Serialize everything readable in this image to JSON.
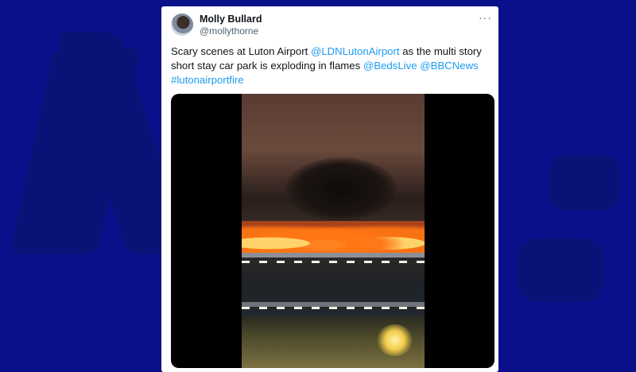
{
  "tweet": {
    "author_name": "Molly Bullard",
    "author_handle": "@mollythorne",
    "more_icon": "···",
    "text_parts": [
      {
        "text": "Scary scenes at Luton Airport ",
        "type": "plain"
      },
      {
        "text": "@LDNLutonAirport",
        "type": "link"
      },
      {
        "text": " as the multi story short stay car park is exploding in flames ",
        "type": "plain"
      },
      {
        "text": "@BedsLive",
        "type": "link"
      },
      {
        "text": " ",
        "type": "plain"
      },
      {
        "text": "@BBCNews",
        "type": "link"
      },
      {
        "text": " ",
        "type": "plain"
      },
      {
        "text": "#lutonairportfire",
        "type": "link"
      }
    ]
  },
  "colors": {
    "background": "#0a0f8a",
    "link": "#1d9bf0",
    "text": "#0f1419",
    "muted": "#536471"
  }
}
